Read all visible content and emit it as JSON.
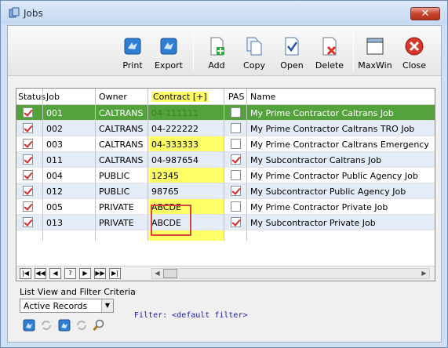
{
  "window": {
    "title": "Jobs",
    "close_glyph": "✕"
  },
  "toolbar": {
    "buttons": [
      {
        "label": "Print",
        "icon": "print-icon"
      },
      {
        "label": "Export",
        "icon": "export-icon"
      },
      {
        "label": "Add",
        "icon": "add-icon"
      },
      {
        "label": "Copy",
        "icon": "copy-icon"
      },
      {
        "label": "Open",
        "icon": "open-icon"
      },
      {
        "label": "Delete",
        "icon": "delete-icon"
      },
      {
        "label": "MaxWin",
        "icon": "maxwin-icon"
      },
      {
        "label": "Close",
        "icon": "close-icon"
      }
    ]
  },
  "grid": {
    "columns": [
      "Status",
      "Job",
      "Owner",
      "Contract [+]",
      "PAS",
      "Name"
    ],
    "rows": [
      {
        "status": true,
        "job": "001",
        "owner": "CALTRANS",
        "contract": "04-111111",
        "pas": false,
        "name": "My Prime Contractor Caltrans Job"
      },
      {
        "status": true,
        "job": "002",
        "owner": "CALTRANS",
        "contract": "04-222222",
        "pas": false,
        "name": "My Prime Contractor Caltrans TRO Job"
      },
      {
        "status": true,
        "job": "003",
        "owner": "CALTRANS",
        "contract": "04-333333",
        "pas": false,
        "name": "My Prime Contractor Caltrans Emergency"
      },
      {
        "status": true,
        "job": "011",
        "owner": "CALTRANS",
        "contract": "04-987654",
        "pas": true,
        "name": "My Subcontractor Caltrans Job"
      },
      {
        "status": true,
        "job": "004",
        "owner": "PUBLIC",
        "contract": "12345",
        "pas": false,
        "name": "My Prime Contractor Public Agency Job"
      },
      {
        "status": true,
        "job": "012",
        "owner": "PUBLIC",
        "contract": "98765",
        "pas": true,
        "name": "My Subcontractor Public Agency Job"
      },
      {
        "status": true,
        "job": "005",
        "owner": "PRIVATE",
        "contract": "ABCDE",
        "pas": false,
        "name": "My Prime Contractor Private Job"
      },
      {
        "status": true,
        "job": "013",
        "owner": "PRIVATE",
        "contract": "ABCDE",
        "pas": true,
        "name": "My Subcontractor Private Job"
      }
    ],
    "selected_row": 0,
    "nav_buttons": [
      "|◀",
      "◀◀",
      "◀",
      "?",
      "▶",
      "▶▶",
      "▶|"
    ]
  },
  "filter": {
    "label": "List View and Filter Criteria",
    "selected": "Active Records",
    "text": "Filter: <default filter>"
  },
  "colors": {
    "selected_row": "#54a23c",
    "contract_highlight": "#ffff66",
    "alt_row": "#e4ecf7",
    "highlight_box": "#d6463a"
  }
}
